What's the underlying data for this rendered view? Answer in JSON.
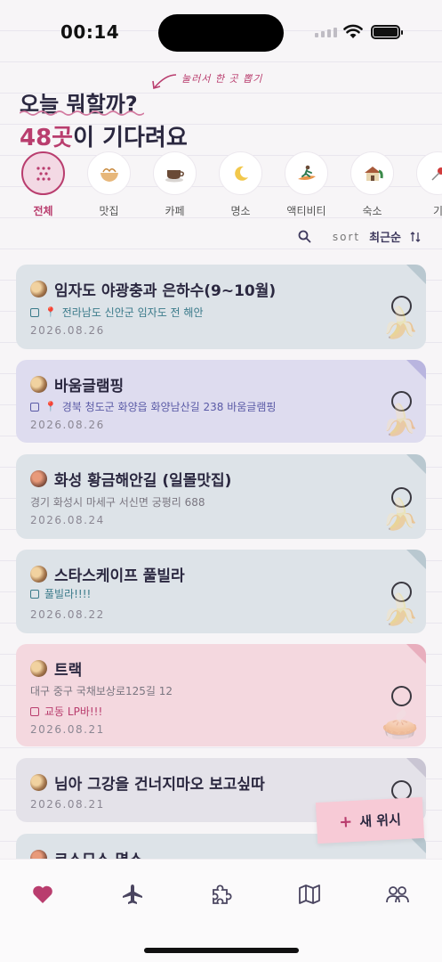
{
  "status_bar": {
    "time": "00:14"
  },
  "header": {
    "hint": "눌러서 한 곳 뽑기",
    "title": "오늘 뭐할까?",
    "count": "48곳",
    "subtitle_rest": "이 기다려요"
  },
  "categories": [
    {
      "label": "전체",
      "icon": "dots-icon",
      "active": true
    },
    {
      "label": "맛집",
      "icon": "noodle-bowl-icon"
    },
    {
      "label": "카페",
      "icon": "coffee-cup-icon"
    },
    {
      "label": "명소",
      "icon": "crescent-moon-icon"
    },
    {
      "label": "액티비티",
      "icon": "surfer-icon"
    },
    {
      "label": "숙소",
      "icon": "house-icon"
    },
    {
      "label": "기",
      "icon": "pin-icon"
    }
  ],
  "sort": {
    "label": "sort",
    "value": "최근순",
    "icon": "search-icon"
  },
  "cards": [
    {
      "title": "임자도 야광충과 은하수(9~10월)",
      "location": "전라남도 신안군 임자도 전 해안",
      "date": "2026.08.26",
      "color": "#dde3e8",
      "fold": "#b9c8d0"
    },
    {
      "title": "바움글램핑",
      "location": "경북 청도군 화양읍 화양남산길 238 바움글램핑",
      "date": "2026.08.26",
      "color": "#dedcef",
      "fold": "#b9b5df"
    },
    {
      "title": "화성 황금해안길 (일몰맛집)",
      "address": "경기 화성시 마세구 서신면 궁평리 688",
      "date": "2026.08.24",
      "color": "#dde3e8",
      "fold": "#b9c8d0"
    },
    {
      "title": "스타스케이프 풀빌라",
      "memo": "풀빌라!!!!",
      "date": "2026.08.22",
      "color": "#dde3e8",
      "fold": "#b9c8d0"
    },
    {
      "title": "트랙",
      "address": "대구 중구 국채보상로125길 12",
      "memo": "교동 LP바!!!",
      "date": "2026.08.21",
      "color": "#f4d8df",
      "fold": "#e8aebd"
    },
    {
      "title": "님아 그강을 건너지마오 보고싶따",
      "date": "2026.08.21",
      "color": "#e4e2e9",
      "fold": "#c9c5d3"
    },
    {
      "title": "코스모스 명소",
      "color": "#dde3e8",
      "fold": "#b9c8d0"
    }
  ],
  "fab": {
    "label": "새 위시"
  },
  "nav": [
    "heart-icon",
    "airplane-icon",
    "puzzle-icon",
    "map-icon",
    "people-icon"
  ],
  "colors": {
    "accent": "#b93d6e",
    "text": "#2b2840"
  }
}
